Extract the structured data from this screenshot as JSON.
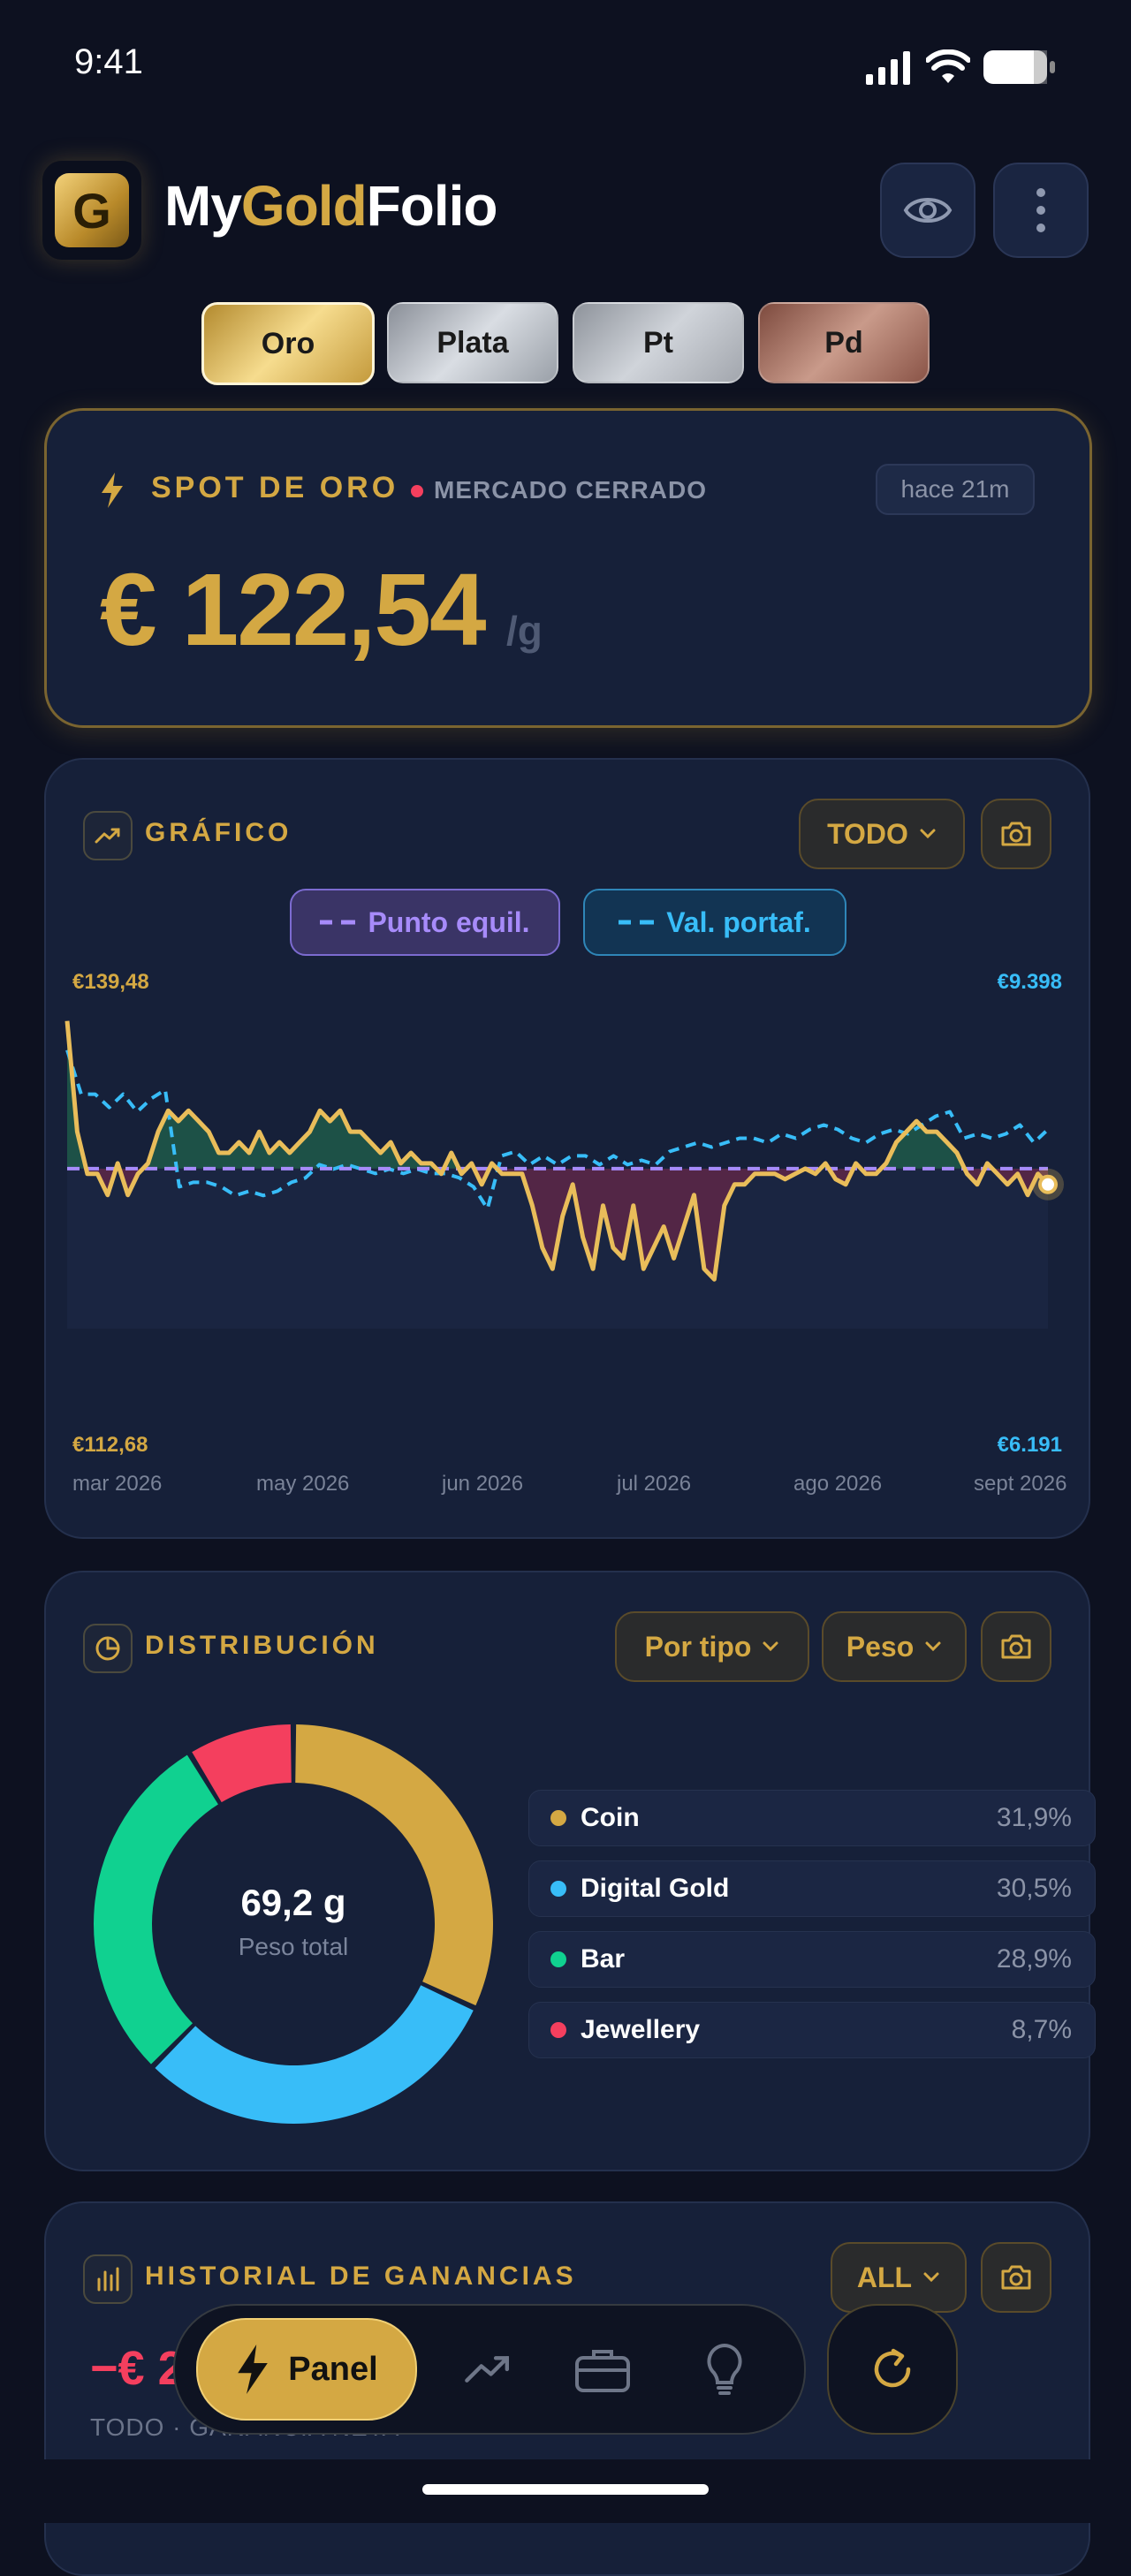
{
  "status_bar": {
    "time": "9:41"
  },
  "header": {
    "brand_pre": "My",
    "brand_mid": "Gold",
    "brand_post": "Folio",
    "logo_letter": "G"
  },
  "metal_tabs": [
    {
      "label": "Oro",
      "active": true
    },
    {
      "label": "Plata",
      "active": false
    },
    {
      "label": "Pt",
      "active": false
    },
    {
      "label": "Pd",
      "active": false
    }
  ],
  "spot": {
    "title": "SPOT DE ORO",
    "market_status": "MERCADO CERRADO",
    "updated": "hace 21m",
    "price": "€ 122,54",
    "unit": "/g"
  },
  "chart_card": {
    "title": "GRÁFICO",
    "range_label": "TODO",
    "legend_breakeven": "Punto equil.",
    "legend_portfolio": "Val. portaf.",
    "left_max": "€139,48",
    "left_min": "€112,68",
    "right_max": "€9.398",
    "right_min": "€6.191"
  },
  "chart_data": {
    "type": "line",
    "x_ticks": [
      "mar 2026",
      "may 2026",
      "jun 2026",
      "jul 2026",
      "ago 2026",
      "sept 2026"
    ],
    "ylim_left": [
      112.68,
      139.48
    ],
    "ylim_right": [
      6191,
      9398
    ],
    "series": [
      {
        "name": "",
        "axis": "left",
        "color": "#e8b94b",
        "values": [
          138.5,
          128,
          124,
          124,
          122,
          125,
          122,
          124,
          125,
          128,
          130,
          129,
          130,
          129,
          128,
          126,
          126,
          127,
          126,
          128,
          126,
          127,
          126,
          127,
          128,
          130,
          129,
          130,
          128,
          128,
          127,
          126,
          127,
          125,
          126,
          125,
          125,
          124,
          126,
          124,
          125,
          123,
          125,
          124,
          124,
          124,
          121,
          117,
          115,
          120,
          123,
          118,
          115,
          121,
          117,
          116,
          121,
          115,
          117,
          119,
          116,
          119,
          122,
          115,
          114,
          121,
          123,
          123,
          124,
          124,
          124,
          123.5,
          124,
          124.5,
          124,
          125,
          123.5,
          123,
          125,
          124,
          124,
          125,
          127,
          128,
          129,
          128,
          128,
          127,
          126,
          124,
          123,
          125,
          124,
          123,
          124,
          122,
          124,
          123
        ]
      },
      {
        "name": "",
        "axis": "right",
        "color": "#38bdf8",
        "values": [
          8950,
          8450,
          8450,
          8300,
          8450,
          8250,
          8400,
          8500,
          7400,
          7450,
          7450,
          7400,
          7300,
          7350,
          7300,
          7350,
          7450,
          7500,
          7650,
          7600,
          7650,
          7600,
          7550,
          7600,
          7550,
          7600,
          7550,
          7550,
          7500,
          7400,
          7150,
          7750,
          7800,
          7650,
          7750,
          7650,
          7750,
          7750,
          7650,
          7750,
          7650,
          7700,
          7650,
          7800,
          7850,
          7900,
          7850,
          7900,
          7950,
          7950,
          7900,
          8000,
          7950,
          8050,
          8100,
          8050,
          7950,
          7900,
          8000,
          8050,
          8000,
          8100,
          8200,
          8250,
          7950,
          8000,
          7950,
          8000,
          8100,
          7900,
          8050
        ]
      }
    ],
    "reference_line": {
      "name": "Punto equil.",
      "value": 124.5,
      "color": "#a78bfa"
    }
  },
  "distribution": {
    "title": "DISTRIBUCIÓN",
    "group_label": "Por tipo",
    "metric_label": "Peso",
    "center_value": "69,2 g",
    "center_label": "Peso total",
    "items": [
      {
        "label": "Coin",
        "value": "31,9%",
        "pct": 31.9,
        "color": "#d4a843"
      },
      {
        "label": "Digital Gold",
        "value": "30,5%",
        "pct": 30.5,
        "color": "#38bdf8"
      },
      {
        "label": "Bar",
        "value": "28,9%",
        "pct": 28.9,
        "color": "#10d190"
      },
      {
        "label": "Jewellery",
        "value": "8,7%",
        "pct": 8.7,
        "color": "#f43f5e"
      }
    ]
  },
  "history": {
    "title": "HISTORIAL DE GANANCIAS",
    "range_label": "ALL",
    "value_partial": "−€ 2",
    "subtitle": "TODO · GANANCIA NETA"
  },
  "nav": {
    "active_label": "Panel"
  }
}
